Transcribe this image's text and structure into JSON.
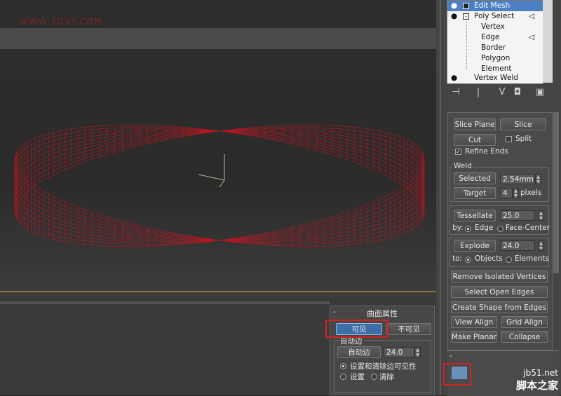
{
  "watermark": "WWW.3DXY.COM",
  "modifier_stack": {
    "items": [
      {
        "label": "Edit Mesh",
        "selected": true,
        "icon": "lightbulb-icon"
      },
      {
        "label": "Poly Select",
        "selected": false,
        "icon": "lightbulb-icon"
      },
      {
        "label": "Vertex",
        "selected": false
      },
      {
        "label": "Edge",
        "selected": false
      },
      {
        "label": "Border",
        "selected": false
      },
      {
        "label": "Polygon",
        "selected": false
      },
      {
        "label": "Element",
        "selected": false
      },
      {
        "label": "Vertex Weld",
        "selected": false,
        "icon": "lightbulb-icon"
      }
    ]
  },
  "edit_geometry": {
    "slice_plane": "Slice Plane",
    "slice": "Slice",
    "cut": "Cut",
    "split": "Split",
    "split_checked": false,
    "refine_ends": "Refine Ends",
    "refine_ends_checked": true,
    "weld": {
      "title": "Weld",
      "selected": "Selected",
      "selected_value": "2.54mm",
      "target": "Target",
      "target_value": "4",
      "target_unit": "pixels"
    },
    "tessellate": "Tessellate",
    "tessellate_value": "25.0",
    "by_label": "by:",
    "edge": "Edge",
    "face_center": "Face-Center",
    "explode": "Explode",
    "explode_value": "24.0",
    "to_label": "to:",
    "objects": "Objects",
    "elements": "Elements",
    "remove_isolated": "Remove Isolated Vertices",
    "select_open_edges": "Select Open Edges",
    "create_shape": "Create Shape from Edges",
    "view_align": "View Align",
    "grid_align": "Grid Align",
    "make_planar": "Make Planar",
    "collapse": "Collapse"
  },
  "surface_properties": {
    "title": "曲面属性",
    "visible": "可见",
    "invisible": "不可见",
    "auto_edge_group": "自动边",
    "auto_edge_button": "自动边",
    "auto_edge_value": "24.0",
    "set_and_clear": "设置和清除边可见性",
    "set": "设置",
    "clear": "清除"
  },
  "footer": {
    "site": "jb51.net",
    "site_name": "脚本之家"
  },
  "colors": {
    "mesh": "#c8141e",
    "highlight": "#d42020",
    "selection": "#4d7fc4"
  }
}
